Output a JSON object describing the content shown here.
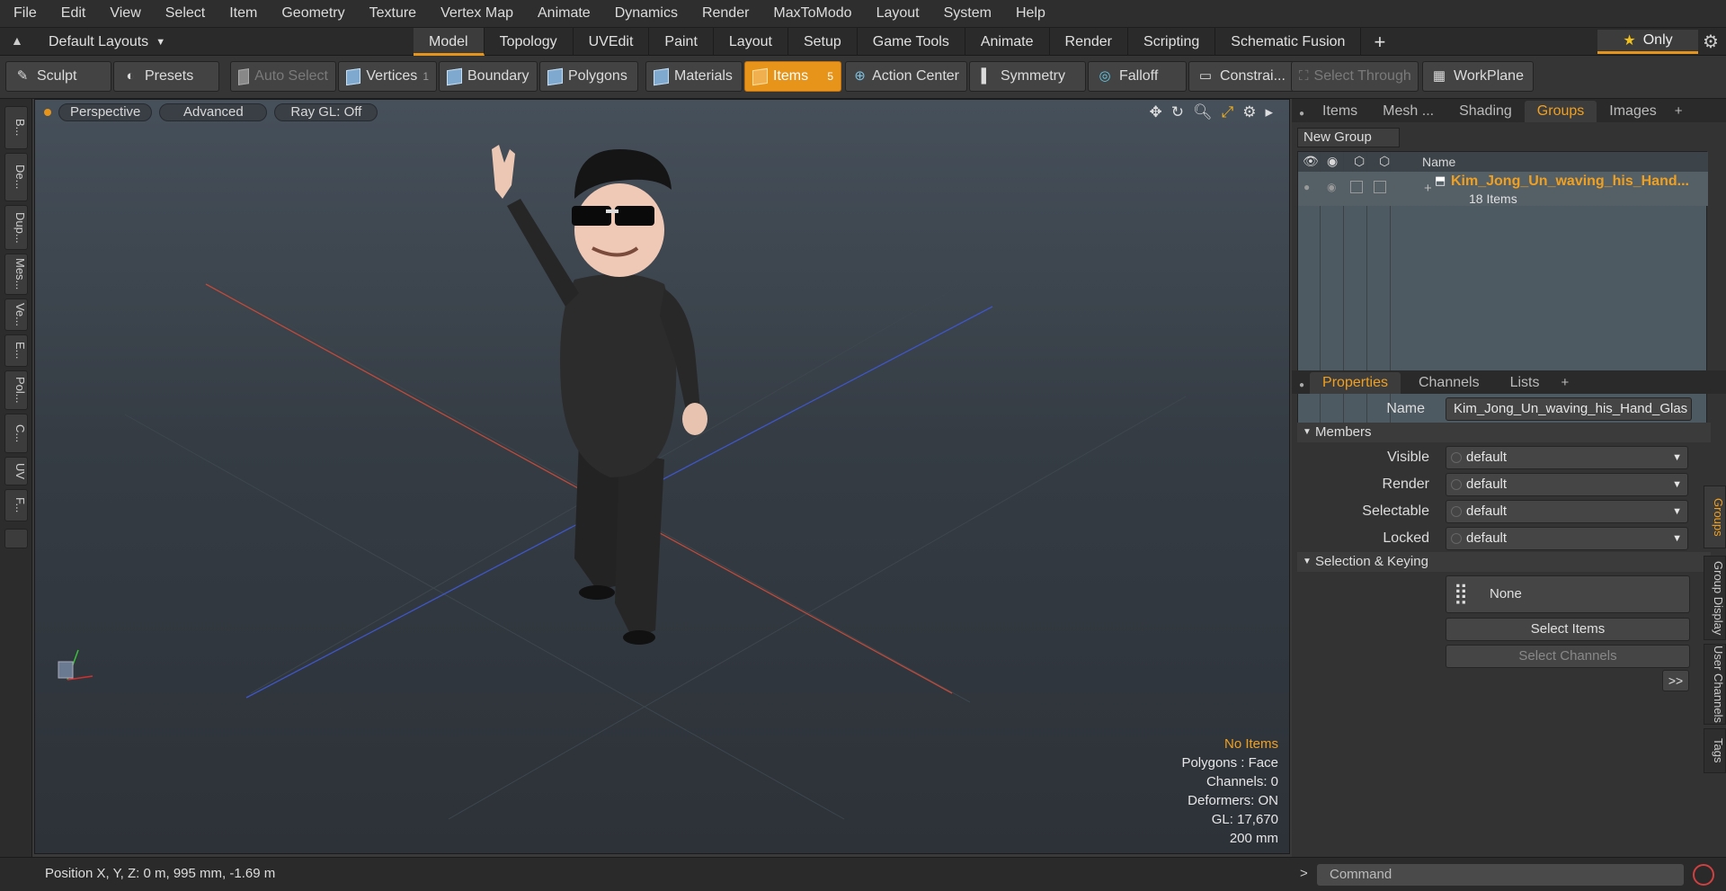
{
  "menu": [
    "File",
    "Edit",
    "View",
    "Select",
    "Item",
    "Geometry",
    "Texture",
    "Vertex Map",
    "Animate",
    "Dynamics",
    "Render",
    "MaxToModo",
    "Layout",
    "System",
    "Help"
  ],
  "layout_selector": "Default Layouts",
  "layout_tabs": [
    "Model",
    "Topology",
    "UVEdit",
    "Paint",
    "Layout",
    "Setup",
    "Game Tools",
    "Animate",
    "Render",
    "Scripting",
    "Schematic Fusion"
  ],
  "active_layout_tab": "Model",
  "only_label": "Only",
  "toolbar": {
    "sculpt": "Sculpt",
    "presets": "Presets",
    "auto_select": "Auto Select",
    "vertices": "Vertices",
    "vertices_count": "1",
    "boundary": "Boundary",
    "polygons": "Polygons",
    "materials": "Materials",
    "items": "Items",
    "items_count": "5",
    "action_center": "Action Center",
    "symmetry": "Symmetry",
    "falloff": "Falloff",
    "constraints": "Constrai...",
    "select_through": "Select Through",
    "workplane": "WorkPlane"
  },
  "left_tools": [
    "B...",
    "De...",
    "Dup...",
    "Mes...",
    "Ve...",
    "E...",
    "Pol...",
    "C...",
    "UV",
    "F..."
  ],
  "viewport": {
    "view": "Perspective",
    "shading": "Advanced",
    "raygl": "Ray GL: Off",
    "hud": {
      "no_items": "No Items",
      "polygons": "Polygons : Face",
      "channels": "Channels: 0",
      "deformers": "Deformers: ON",
      "gl": "GL: 17,670",
      "scale": "200 mm"
    }
  },
  "groups_panel": {
    "tabs": [
      "Items",
      "Mesh ...",
      "Shading",
      "Groups",
      "Images"
    ],
    "active_tab": "Groups",
    "new_group": "New Group",
    "name_header": "Name",
    "group_name": "Kim_Jong_Un_waving_his_Hand...",
    "group_count": "18 Items"
  },
  "properties_panel": {
    "tabs": [
      "Properties",
      "Channels",
      "Lists"
    ],
    "active_tab": "Properties",
    "name_label": "Name",
    "name_value": "Kim_Jong_Un_waving_his_Hand_Glas",
    "members_section": "Members",
    "rows": [
      {
        "label": "Visible",
        "value": "default"
      },
      {
        "label": "Render",
        "value": "default"
      },
      {
        "label": "Selectable",
        "value": "default"
      },
      {
        "label": "Locked",
        "value": "default"
      }
    ],
    "selection_section": "Selection & Keying",
    "none_label": "None",
    "select_items": "Select Items",
    "select_channels": "Select Channels",
    "more": ">>",
    "side_tabs": [
      "Groups",
      "Group Display",
      "User Channels",
      "Tags"
    ]
  },
  "status": {
    "position": "Position X, Y, Z:   0 m, 995 mm, -1.69 m",
    "command_placeholder": "Command",
    "prompt": ">"
  }
}
